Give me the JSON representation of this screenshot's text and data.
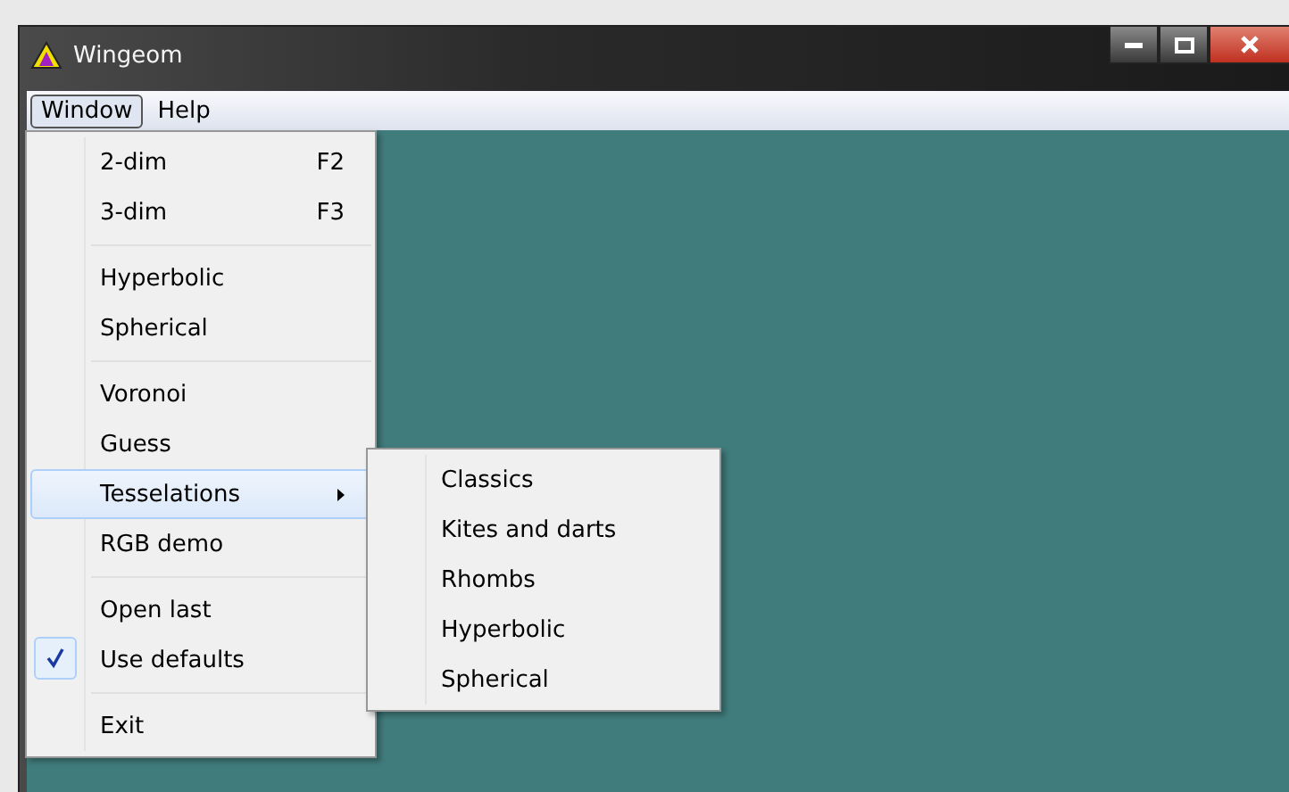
{
  "window": {
    "title": "Wingeom"
  },
  "menubar": [
    {
      "label": "Window",
      "selected": true
    },
    {
      "label": "Help",
      "selected": false
    }
  ],
  "menu": [
    {
      "kind": "item",
      "label": "2-dim",
      "shortcut": "F2",
      "checked": false,
      "selected": false
    },
    {
      "kind": "item",
      "label": "3-dim",
      "shortcut": "F3",
      "checked": false,
      "selected": false
    },
    {
      "kind": "separator"
    },
    {
      "kind": "item",
      "label": "Hyperbolic",
      "checked": false,
      "selected": false
    },
    {
      "kind": "item",
      "label": "Spherical",
      "checked": false,
      "selected": false
    },
    {
      "kind": "separator"
    },
    {
      "kind": "item",
      "label": "Voronoi",
      "checked": false,
      "selected": false
    },
    {
      "kind": "item",
      "label": "Guess",
      "checked": false,
      "selected": false
    },
    {
      "kind": "submenu",
      "label": "Tesselations",
      "checked": false,
      "selected": true
    },
    {
      "kind": "item",
      "label": "RGB demo",
      "checked": false,
      "selected": false
    },
    {
      "kind": "separator"
    },
    {
      "kind": "item",
      "label": "Open last",
      "checked": false,
      "selected": false
    },
    {
      "kind": "item",
      "label": "Use defaults",
      "checked": true,
      "selected": false
    },
    {
      "kind": "separator"
    },
    {
      "kind": "item",
      "label": "Exit",
      "checked": false,
      "selected": false
    }
  ],
  "submenu": [
    {
      "label": "Classics",
      "selected": false
    },
    {
      "label": "Kites and darts",
      "selected": false
    },
    {
      "label": "Rhombs",
      "selected": false
    },
    {
      "label": "Hyperbolic",
      "selected": false
    },
    {
      "label": "Spherical",
      "selected": false
    }
  ]
}
